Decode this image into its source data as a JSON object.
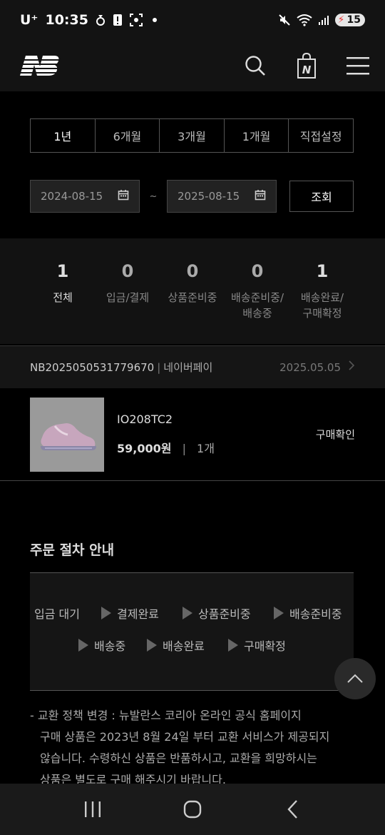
{
  "status_bar": {
    "carrier": "U⁺",
    "time": "10:35",
    "battery_level": "15"
  },
  "header": {
    "logo_name": "new-balance-logo",
    "icons": [
      "search-icon",
      "shopping-bag-icon",
      "menu-icon"
    ],
    "bag_letter": "N"
  },
  "period_tabs": {
    "items": [
      "1년",
      "6개월",
      "3개월",
      "1개월",
      "직접설정"
    ],
    "selected": "1년"
  },
  "date_range": {
    "start": "2024-08-15",
    "separator": "~",
    "end": "2025-08-15",
    "search_label": "조회"
  },
  "summary": {
    "items": [
      {
        "count": "1",
        "label": "전체"
      },
      {
        "count": "0",
        "label": "입금/결제"
      },
      {
        "count": "0",
        "label": "상품준비중"
      },
      {
        "count": "0",
        "label_line1": "배송준비중/",
        "label_line2": "배송중"
      },
      {
        "count": "1",
        "label_line1": "배송완료/",
        "label_line2": "구매확정"
      }
    ]
  },
  "order": {
    "number": "NB2025050531779670",
    "separator": "|",
    "payment": "네이버페이",
    "date": "2025.05.05",
    "item": {
      "name": "IO208TC2",
      "price": "59,000원",
      "bar": "|",
      "quantity": "1개",
      "status": "구매확인"
    }
  },
  "guide": {
    "title": "주문 절차 안내",
    "steps": [
      "입금 대기",
      "결제완료",
      "상품준비중",
      "배송준비중",
      "배송중",
      "배송완료",
      "구매확정"
    ]
  },
  "notice": {
    "line1": "- 교환 정책 변경 : 뉴발란스 코리아 온라인 공식 홈페이지",
    "line2": "구매 상품은 2023년 8월 24일 부터 교환 서비스가 제공되지",
    "line3": "않습니다. 수령하신 상품은 반품하시고, 교환을 희망하시는",
    "line4": "상품은 별도로 구매 해주시기 바랍니다."
  },
  "colors": {
    "background": "#000000",
    "header_bg": "#131313",
    "summary_bg": "#121212",
    "text_primary": "#dddddd",
    "text_muted": "#888888",
    "border": "#555555",
    "product_thumb_bg": "#9a9a9a",
    "shoe_color": "#c7a6bd"
  }
}
